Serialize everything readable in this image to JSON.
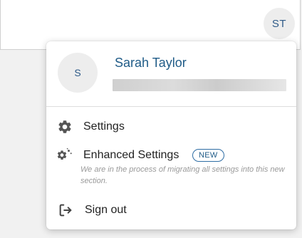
{
  "topbar": {
    "avatar_initials": "ST"
  },
  "user_menu": {
    "avatar_initial": "S",
    "user_name": "Sarah Taylor",
    "items": [
      {
        "label": "Settings",
        "icon": "gear-icon"
      },
      {
        "label": "Enhanced Settings",
        "icon": "gear-sparkle-icon",
        "badge": "NEW",
        "description": "We are in the process of migrating all settings into this new section."
      },
      {
        "label": "Sign out",
        "icon": "sign-out-icon"
      }
    ]
  },
  "colors": {
    "accent": "#1f5b87",
    "avatar_bg": "#ededed",
    "page_bg": "#f1f1f1"
  }
}
